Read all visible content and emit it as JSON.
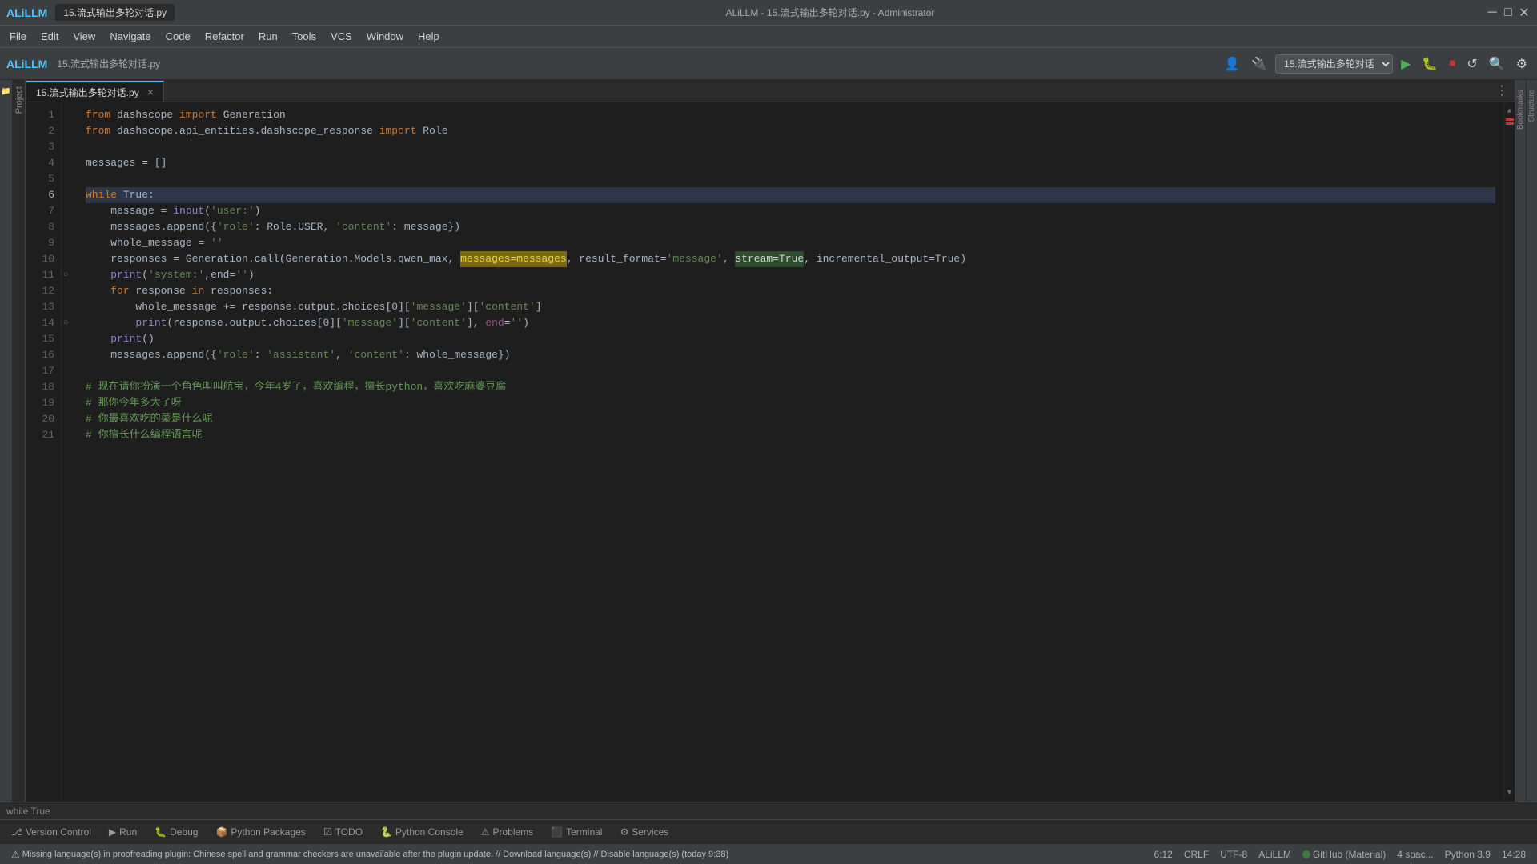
{
  "titleBar": {
    "appName": "ALiLLM",
    "fileTab": "15.流式输出多轮对话.py",
    "title": "ALiLLM - 15.流式输出多轮对话.py - Administrator",
    "minimize": "─",
    "maximize": "□",
    "close": "✕"
  },
  "menuBar": {
    "items": [
      "File",
      "Edit",
      "View",
      "Navigate",
      "Code",
      "Refactor",
      "Run",
      "Tools",
      "VCS",
      "Window",
      "Help"
    ]
  },
  "toolbar": {
    "appName": "ALiLLM",
    "fileTabTitle": "15.流式输出多轮对话.py",
    "runConfigLabel": "15.流式输出多轮对话",
    "userIcon": "👤",
    "pluginIcon": "🔌"
  },
  "editorTab": {
    "fileName": "15.流式输出多轮对话.py",
    "moreIcon": "⋮"
  },
  "codeLines": [
    {
      "num": 1,
      "content": "from dashscope import Generation",
      "highlight": false
    },
    {
      "num": 2,
      "content": "from dashscope.api_entities.dashscope_response import Role",
      "highlight": false
    },
    {
      "num": 3,
      "content": "",
      "highlight": false
    },
    {
      "num": 4,
      "content": "messages = []",
      "highlight": false
    },
    {
      "num": 5,
      "content": "",
      "highlight": false
    },
    {
      "num": 6,
      "content": "while True:",
      "highlight": true
    },
    {
      "num": 7,
      "content": "    message = input('user:')",
      "highlight": false
    },
    {
      "num": 8,
      "content": "    messages.append({'role': Role.USER, 'content': message})",
      "highlight": false
    },
    {
      "num": 9,
      "content": "    whole_message = ''",
      "highlight": false
    },
    {
      "num": 10,
      "content": "    responses = Generation.call(Generation.Models.qwen_max, messages=messages, result_format='message', stream=True, incremental_output=True)",
      "highlight": false
    },
    {
      "num": 11,
      "content": "    print('system:',end='')",
      "highlight": false
    },
    {
      "num": 12,
      "content": "    for response in responses:",
      "highlight": false
    },
    {
      "num": 13,
      "content": "        whole_message += response.output.choices[0]['message']['content']",
      "highlight": false
    },
    {
      "num": 14,
      "content": "        print(response.output.choices[0]['message']['content'], end='')",
      "highlight": false
    },
    {
      "num": 15,
      "content": "    print()",
      "highlight": false
    },
    {
      "num": 16,
      "content": "    messages.append({'role': 'assistant', 'content': whole_message})",
      "highlight": false
    },
    {
      "num": 17,
      "content": "",
      "highlight": false
    },
    {
      "num": 18,
      "content": "# 现在请你扮演一个角色叫叫航宝，今年4岁了，喜欢编程，擅长python，喜欢吃麻婆豆腐",
      "highlight": false
    },
    {
      "num": 19,
      "content": "# 那你今年多大了呀",
      "highlight": false
    },
    {
      "num": 20,
      "content": "# 你最喜欢吃的菜是什么呢",
      "highlight": false
    },
    {
      "num": 21,
      "content": "# 你擅长什么编程语言呢",
      "highlight": false
    }
  ],
  "whileTrueBar": {
    "text": "while True"
  },
  "bottomTabs": [
    {
      "label": "Version Control",
      "icon": "⎇",
      "active": false
    },
    {
      "label": "Run",
      "icon": "▶",
      "active": false
    },
    {
      "label": "Debug",
      "icon": "🐛",
      "active": false
    },
    {
      "label": "Python Packages",
      "icon": "📦",
      "active": false
    },
    {
      "label": "TODO",
      "icon": "☑",
      "active": false
    },
    {
      "label": "Python Console",
      "icon": "🐍",
      "active": false
    },
    {
      "label": "Problems",
      "icon": "⚠",
      "active": false
    },
    {
      "label": "Terminal",
      "icon": "⬛",
      "active": false
    },
    {
      "label": "Services",
      "icon": "⚙",
      "active": false
    }
  ],
  "statusBar": {
    "warningText": "Missing language(s) in proofreading plugin: Chinese spell and grammar checkers are unavailable after the plugin update. // Download language(s) // Disable language(s) (today 9:38)",
    "warningIcon": "⚠",
    "position": "6:12",
    "lineEnding": "CRLF",
    "encoding": "UTF-8",
    "pluginLabel": "ALiLLM",
    "vcsLabel": "GitHub (Material)",
    "statusDot": "●",
    "indent": "4 spac...",
    "language": "Python 3.9",
    "time": "14:28"
  },
  "errorMarks": [
    {
      "line": 1
    },
    {
      "line": 2
    }
  ],
  "sidebar": {
    "projectLabel": "Project",
    "bookmarksLabel": "Bookmarks",
    "structureLabel": "Structure"
  }
}
